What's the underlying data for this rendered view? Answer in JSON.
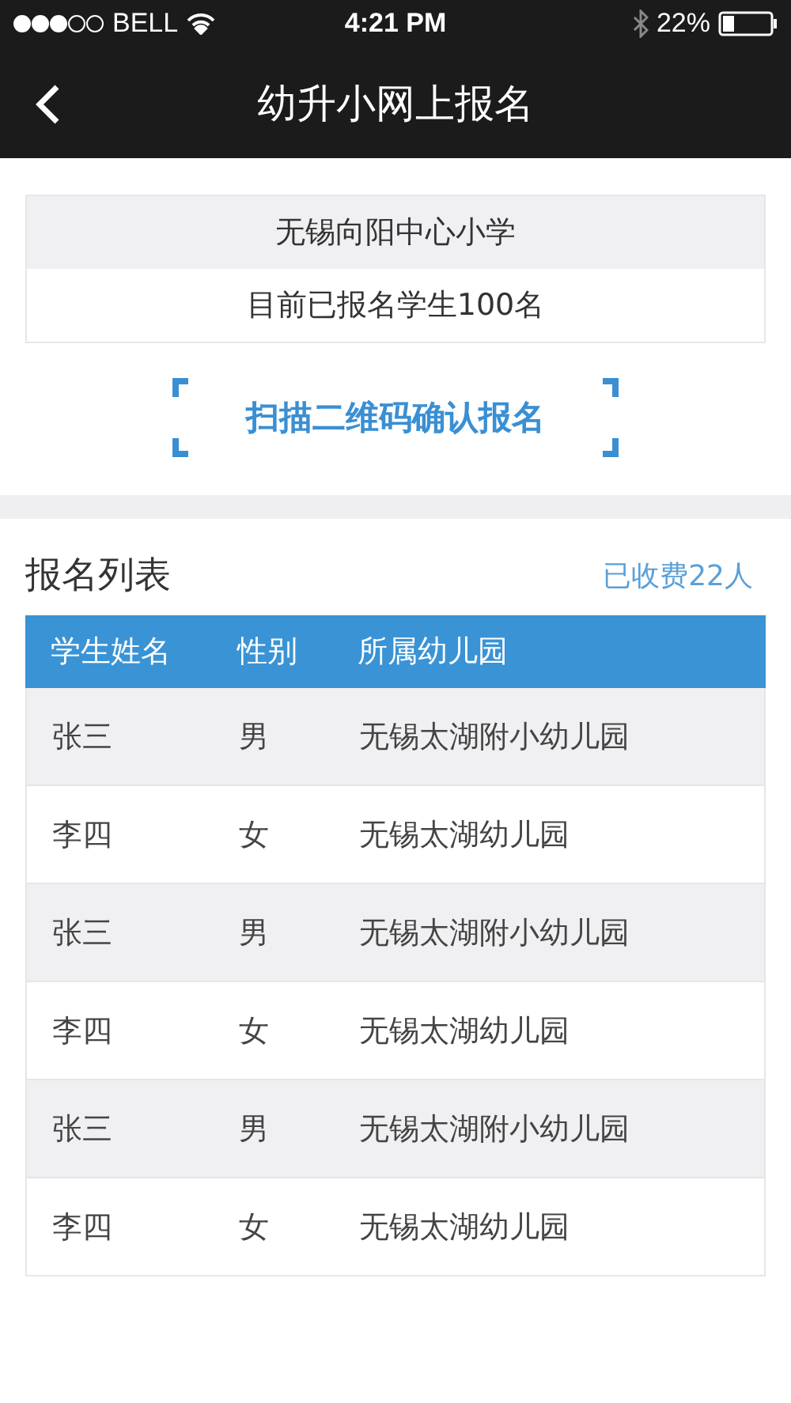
{
  "status_bar": {
    "carrier": "BELL",
    "time": "4:21 PM",
    "battery": "22%"
  },
  "nav": {
    "title": "幼升小网上报名"
  },
  "school": {
    "name": "无锡向阳中心小学",
    "count": "目前已报名学生100名"
  },
  "scan_button": "扫描二维码确认报名",
  "list": {
    "title": "报名列表",
    "paid": "已收费22人",
    "columns": [
      "学生姓名",
      "性别",
      "所属幼儿园"
    ],
    "rows": [
      {
        "name": "张三",
        "gender": "男",
        "kindergarten": "无锡太湖附小幼儿园"
      },
      {
        "name": "李四",
        "gender": "女",
        "kindergarten": "无锡太湖幼儿园"
      },
      {
        "name": "张三",
        "gender": "男",
        "kindergarten": "无锡太湖附小幼儿园"
      },
      {
        "name": "李四",
        "gender": "女",
        "kindergarten": "无锡太湖幼儿园"
      },
      {
        "name": "张三",
        "gender": "男",
        "kindergarten": "无锡太湖附小幼儿园"
      },
      {
        "name": "李四",
        "gender": "女",
        "kindergarten": "无锡太湖幼儿园"
      }
    ]
  }
}
